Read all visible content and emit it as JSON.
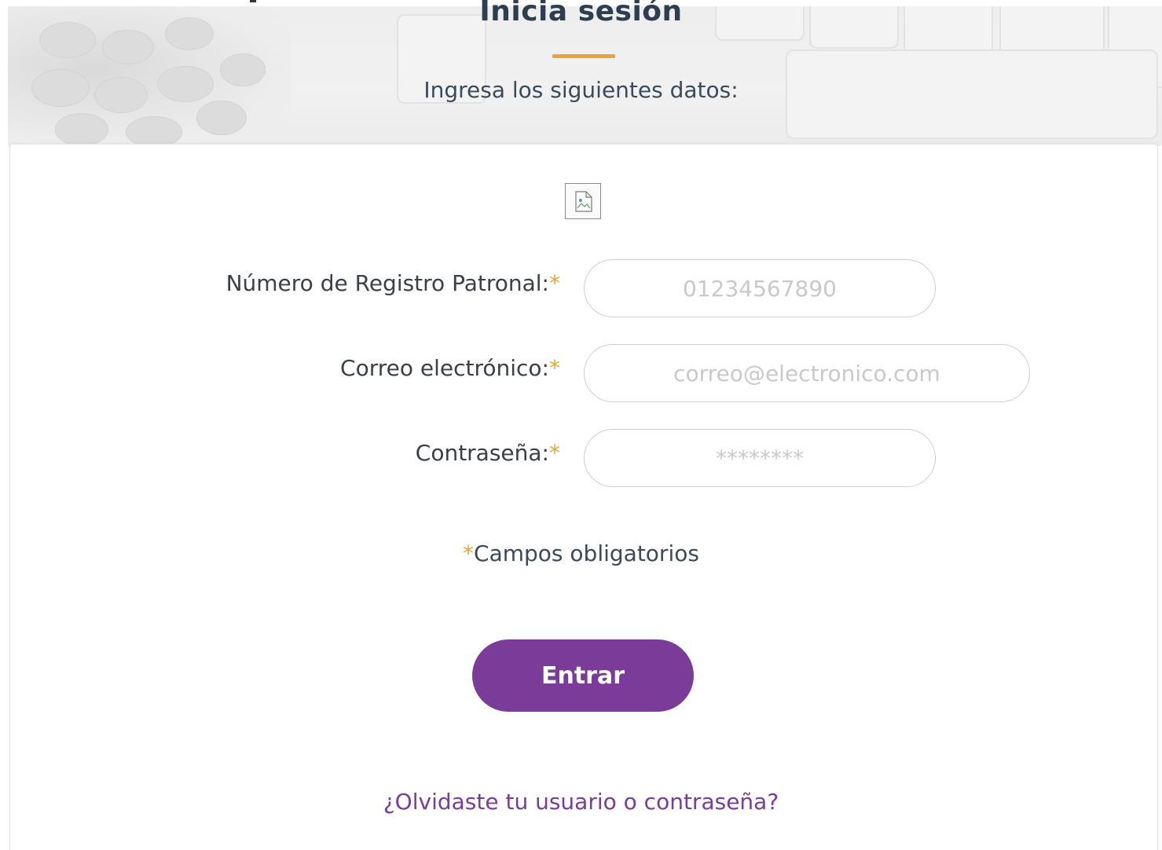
{
  "header": {
    "title": "Inicia sesión",
    "subtitle": "Ingresa los siguientes datos:"
  },
  "form": {
    "logo_icon": "broken-image-icon",
    "required_mark": "*",
    "fields": [
      {
        "label": "Número de Registro Patronal:",
        "placeholder": "01234567890",
        "value": ""
      },
      {
        "label": "Correo electrónico:",
        "placeholder": "correo@electronico.com",
        "value": ""
      },
      {
        "label": "Contraseña:",
        "placeholder": "********",
        "value": ""
      }
    ],
    "required_note": "Campos obligatorios",
    "submit_label": "Entrar",
    "forgot_link": "¿Olvidaste tu usuario o contraseña?"
  },
  "colors": {
    "accent": "#e8a33a",
    "primary": "#7b3b99",
    "heading": "#2d3e50"
  }
}
